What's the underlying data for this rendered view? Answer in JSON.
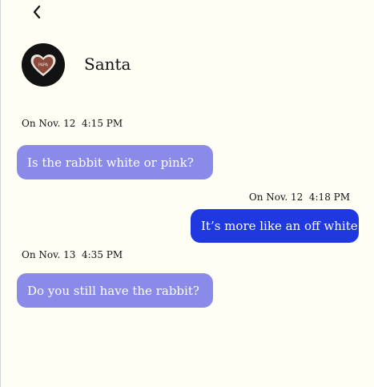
{
  "header": {
    "back_icon": "chevron-left-icon",
    "contact_name": "Santa",
    "avatar_icon": "heart-cookie-icon",
    "avatar_text": "PAPA"
  },
  "messages": [
    {
      "direction": "incoming",
      "date": "On Nov. 12",
      "time": "4:15 PM",
      "text": "Is the rabbit white or pink?"
    },
    {
      "direction": "outgoing",
      "date": "On Nov. 12",
      "time": "4:18 PM",
      "text": "It’s more like an off white."
    },
    {
      "direction": "incoming",
      "date": "On Nov. 13",
      "time": "4:35 PM",
      "text": "Do you still have the rabbit?"
    }
  ],
  "colors": {
    "background": "#FFFEF5",
    "incoming_bubble": "#8A8AE8",
    "outgoing_bubble": "#2038DF",
    "avatar_background": "#121212"
  }
}
